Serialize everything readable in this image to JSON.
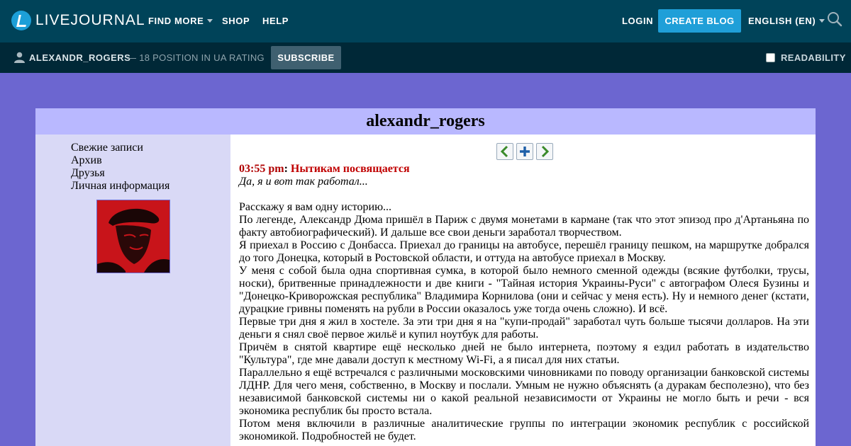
{
  "topbar": {
    "brand": "LIVEJOURNAL",
    "find_more": "FIND MORE",
    "shop": "SHOP",
    "help": "HELP",
    "login": "LOGIN",
    "create_blog": "CREATE BLOG",
    "language": "ENGLISH (EN)",
    "icons": {
      "logo": "livejournal-logo",
      "search": "search-icon",
      "dropdown": "chevron-down-icon"
    },
    "colors": {
      "bar": "#004359",
      "accent": "#1f9fd8"
    }
  },
  "subbar": {
    "username": "ALEXANDR_ROGERS",
    "rating": "— 18 POSITION IN UA RATING",
    "subscribe": "SUBSCRIBE",
    "readability": "READABILITY",
    "readability_checked": false,
    "colors": {
      "bar": "#002837"
    }
  },
  "journal": {
    "title": "alexandr_rogers",
    "colors": {
      "background": "#6c66d0",
      "header": "#b9b8ff",
      "sidebar": "#d9d9f6"
    }
  },
  "sidebar": {
    "links": [
      "Свежие записи",
      "Архив",
      "Друзья",
      "Личная информация"
    ]
  },
  "entry_nav": {
    "prev_icon": "arrow-left-icon",
    "add_icon": "plus-icon",
    "next_icon": "arrow-right-icon"
  },
  "post": {
    "time": "03:55 pm",
    "colon": ":",
    "title": "Нытикам посвящается",
    "subtitle": "Да, я и вот так работал...",
    "paragraphs": [
      "Расскажу я вам одну историю...",
      "По легенде, Александр Дюма пришёл в Париж с двумя монетами в кармане (так что этот эпизод про д'Артаньяна по факту автобиографический). И дальше все свои деньги заработал творчеством.",
      "Я приехал в Россию с Донбасса. Приехал до границы на автобусе, перешёл границу пешком, на маршрутке добрался до того Донецка, который в Ростовской области, и оттуда на автобусе приехал в Москву.",
      "У меня с собой была одна спортивная сумка, в которой было немного сменной одежды (всякие футболки, трусы, носки), бритвенные принадлежности и две книги - \"Тайная история Украины-Руси\" с автографом Олеся Бузины и \"Донецко-Криворожская республика\" Владимира Корнилова (они и сейчас у меня есть). Ну и немного денег (кстати, дурацкие гривны поменять на рубли в России оказалось уже тогда очень сложно). И всё.",
      "Первые три дня я жил в хостеле. За эти три дня я на \"купи-продай\" заработал чуть больше тысячи долларов. На эти деньги я снял своё первое жильё и купил ноутбук для работы.",
      "Причём в снятой квартире ещё несколько дней не было интернета, поэтому я ездил работать в издательство \"Культура\", где мне давали доступ к местному Wi-Fi, а я писал для них статьи.",
      "Параллельно я ещё встречался с различными московскими чиновниками по поводу организации банковской системы ЛДНР. Для чего меня, собственно, в Москву и послали. Умным не нужно объяснять (а дуракам бесполезно), что без независимой банковской системы ни о какой реальной независимости от Украины не могло быть и речи - вся экономика республик бы просто встала.",
      "Потом меня включили в различные аналитические группы по интеграции экономик республик с российской экономикой. Подробностей не будет."
    ]
  }
}
